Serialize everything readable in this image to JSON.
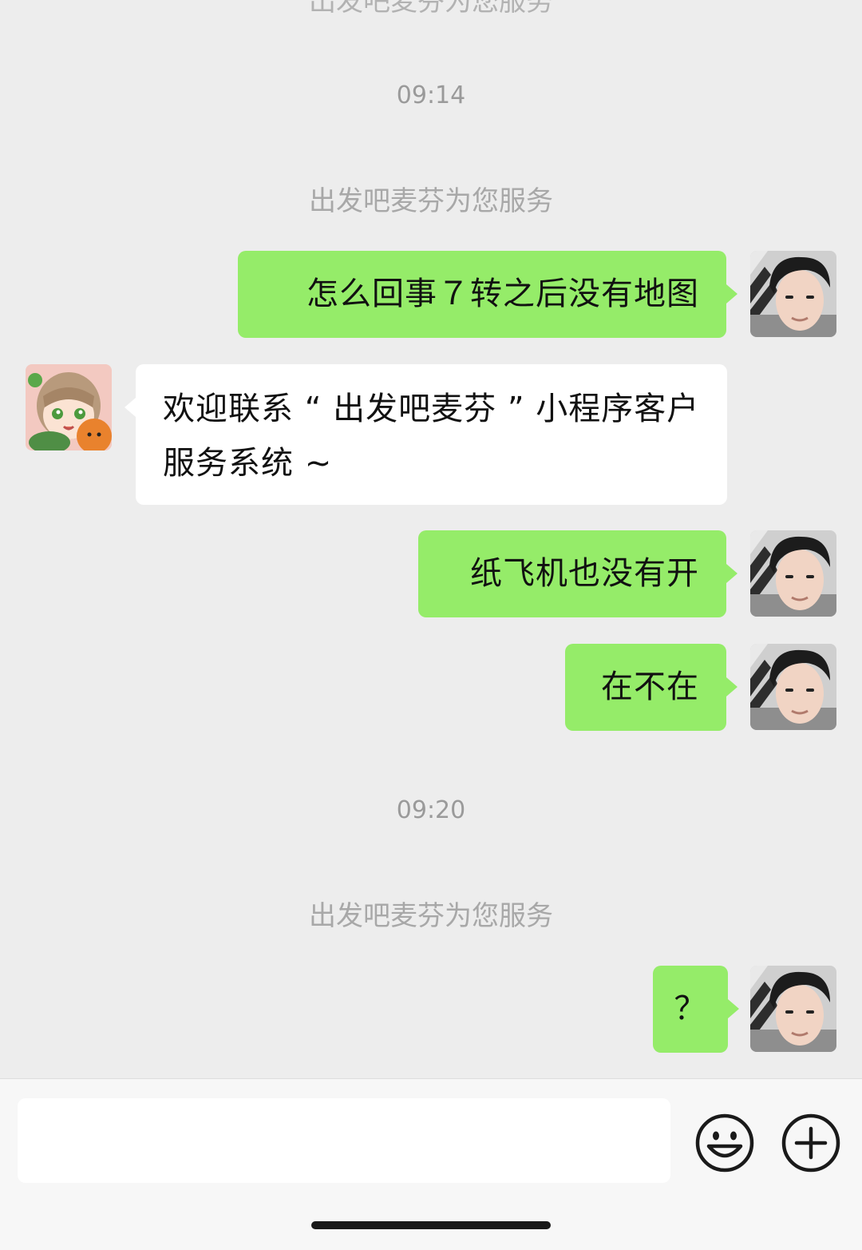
{
  "chat": {
    "top_partial_text": "出发吧麦芬为您服务",
    "timestamps": [
      "09:14",
      "09:20"
    ],
    "system_notices": [
      "出发吧麦芬为您服务",
      "出发吧麦芬为您服务"
    ],
    "messages": [
      {
        "sender": "me",
        "text": "怎么回事７转之后没有地图"
      },
      {
        "sender": "service",
        "text": "欢迎联系 “ 出发吧麦芬 ” 小程序客户服务系统 ~"
      },
      {
        "sender": "me",
        "text": "纸飞机也没有开"
      },
      {
        "sender": "me",
        "text": "在不在"
      },
      {
        "sender": "me",
        "text": "？"
      }
    ]
  },
  "input_bar": {
    "input_value": "",
    "emoji_icon": "smiley-face-icon",
    "more_icon": "plus-circle-icon"
  },
  "colors": {
    "background": "#ededed",
    "outgoing_bubble": "#95ec69",
    "incoming_bubble": "#ffffff",
    "input_bar": "#f7f7f7"
  }
}
